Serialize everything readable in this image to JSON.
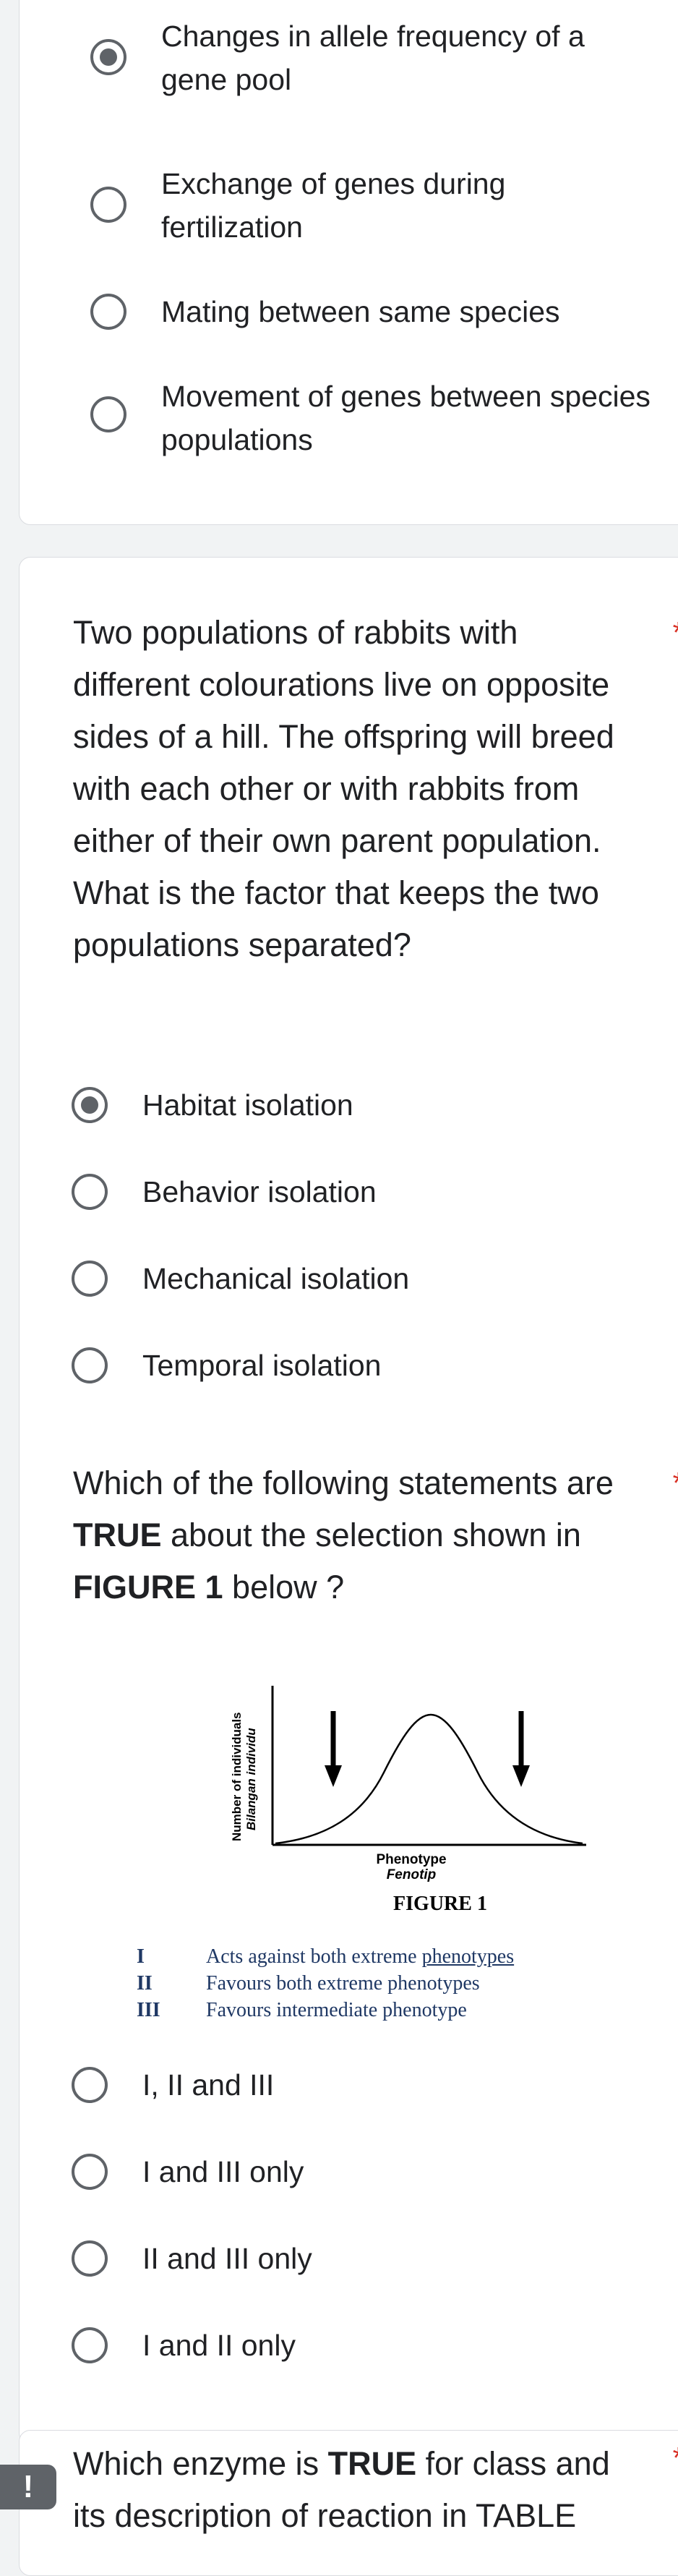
{
  "q1": {
    "options": [
      {
        "label": "Changes in allele frequency of a gene pool",
        "checked": true
      },
      {
        "label": "Exchange of genes during fertilization",
        "checked": false
      },
      {
        "label": "Mating between same species",
        "checked": false
      },
      {
        "label": "Movement of genes between species populations",
        "checked": false
      }
    ]
  },
  "q2": {
    "text": "Two populations of rabbits with different colourations live on opposite sides of a hill. The offspring will breed with each other or with rabbits from either of their own parent population. What is the factor that keeps the two populations separated?",
    "required": "*",
    "options": [
      {
        "label": "Habitat isolation",
        "checked": true
      },
      {
        "label": "Behavior isolation",
        "checked": false
      },
      {
        "label": "Mechanical isolation",
        "checked": false
      },
      {
        "label": "Temporal isolation",
        "checked": false
      }
    ]
  },
  "q3": {
    "text_pre": "Which of the following statements are ",
    "text_bold1": "TRUE",
    "text_mid": " about the selection shown in ",
    "text_bold2": "FIGURE 1",
    "text_post": " below ?",
    "required": "*",
    "figure": {
      "ylabel1": "Number of individuals",
      "ylabel2": "Bilangan individu",
      "xlabel1": "Phenotype",
      "xlabel2": "Fenotip",
      "caption": "FIGURE 1"
    },
    "statements": [
      {
        "num": "I",
        "text_pre": "Acts against both extreme ",
        "text_u": "phenotypes"
      },
      {
        "num": "II",
        "text_pre": "Favours both extreme phenotypes",
        "text_u": ""
      },
      {
        "num": "III",
        "text_pre": "Favours intermediate phenotype",
        "text_u": ""
      }
    ],
    "options": [
      {
        "label": "I, II and III",
        "checked": false
      },
      {
        "label": "I and III only",
        "checked": false
      },
      {
        "label": "II and III only",
        "checked": false
      },
      {
        "label": "I and II only",
        "checked": false
      }
    ]
  },
  "q4": {
    "text_pre": "Which enzyme is ",
    "text_bold": "TRUE",
    "text_post": " for class and its description of reaction in TABLE",
    "required": "*"
  },
  "feedback_icon": "alert-icon",
  "feedback_glyph": "!"
}
